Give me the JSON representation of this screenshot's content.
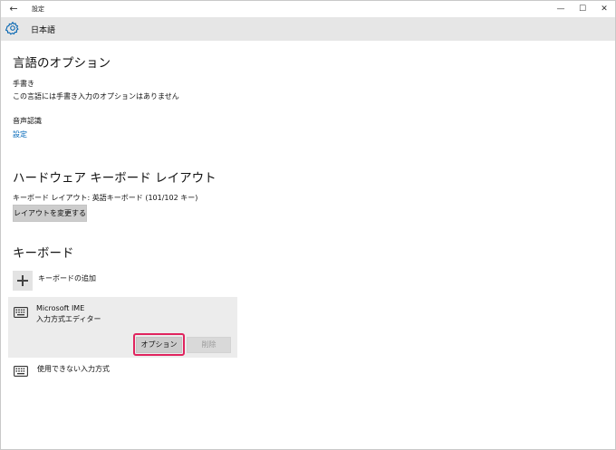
{
  "window": {
    "title": "設定",
    "back_glyph": "←",
    "minimize_glyph": "—",
    "maximize_glyph": "☐",
    "close_glyph": "✕"
  },
  "header": {
    "icon": "gear-icon",
    "title": "日本語"
  },
  "language_options": {
    "title": "言語のオプション",
    "handwriting_label": "手書き",
    "handwriting_value": "この言語には手書き入力のオプションはありません",
    "speech_label": "音声認識",
    "speech_link": "設定"
  },
  "hardware_keyboard": {
    "title": "ハードウェア キーボード レイアウト",
    "layout_text": "キーボード レイアウト: 英語キーボード (101/102 キー)",
    "change_button": "レイアウトを変更する"
  },
  "keyboard": {
    "title": "キーボード",
    "add_label": "キーボードの追加",
    "add_icon": "plus-icon",
    "items": [
      {
        "name": "Microsoft IME",
        "description": "入力方式エディター",
        "icon": "keyboard-icon"
      }
    ],
    "options_button": "オプション",
    "remove_button": "削除",
    "unavailable_label": "使用できない入力方式"
  },
  "colors": {
    "accent_link": "#0067b8",
    "highlight": "#e0245e",
    "header_bg": "#e6e6e6",
    "button_bg": "#cccccc"
  }
}
